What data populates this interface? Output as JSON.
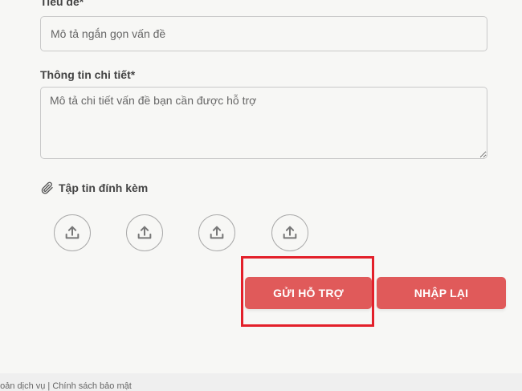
{
  "form": {
    "title_label": "Tiêu đề",
    "required_mark": "*",
    "title_placeholder": "Mô tả ngắn gọn vấn đề",
    "detail_label": "Thông tin chi tiết",
    "detail_placeholder": "Mô tả chi tiết vấn đề bạn cần được hỗ trợ",
    "attachments_label": "Tập tin đính kèm",
    "upload_slots": [
      "upload-icon",
      "upload-icon",
      "upload-icon",
      "upload-icon"
    ]
  },
  "buttons": {
    "submit_label": "GỬI HỖ TRỢ",
    "reset_label": "NHẬP LẠI"
  },
  "footer": {
    "links_text": "hoản dịch vụ | Chính sách bảo mật"
  },
  "colors": {
    "button_bg": "#e05a5a",
    "highlight_border": "#e3202a",
    "page_bg": "#f7f7f5"
  }
}
